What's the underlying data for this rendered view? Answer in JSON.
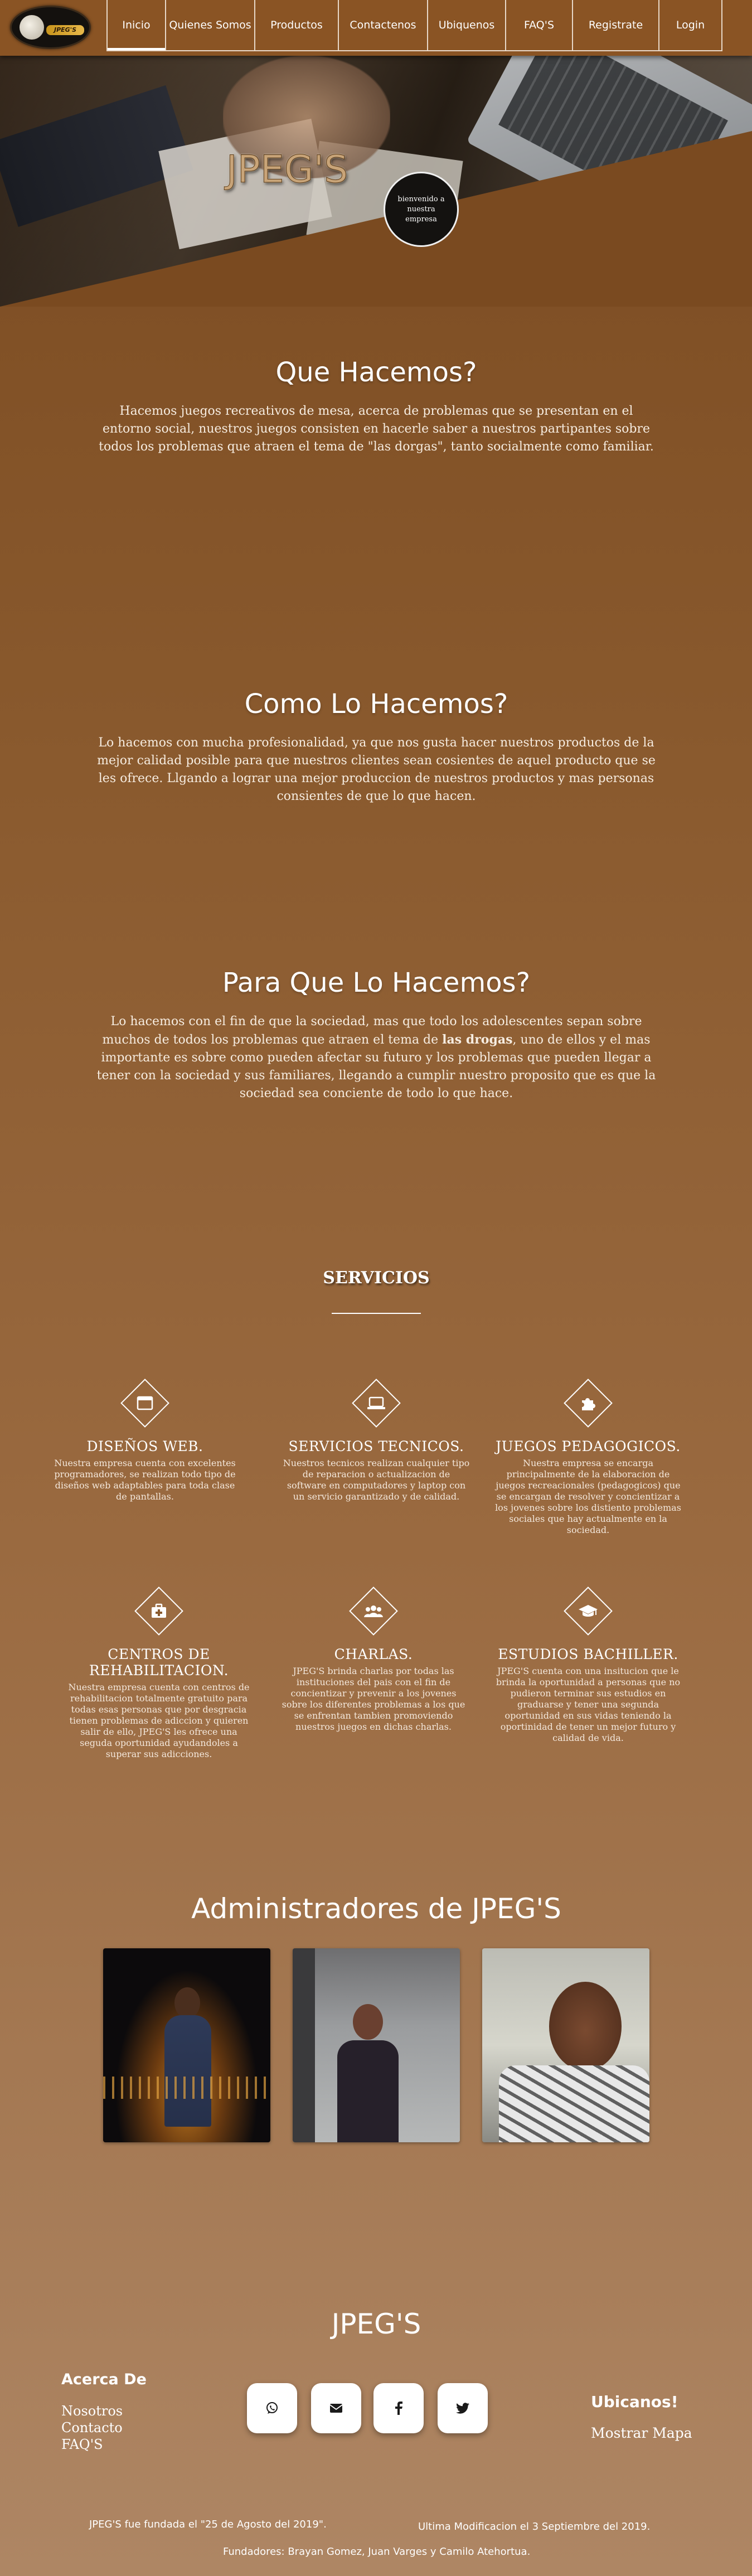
{
  "nav": {
    "logo_text": "JPEG'S",
    "items": [
      {
        "label": "Inicio"
      },
      {
        "label": "Quienes Somos"
      },
      {
        "label": "Productos"
      },
      {
        "label": "Contactenos"
      },
      {
        "label": "Ubiquenos"
      },
      {
        "label": "FAQ'S"
      },
      {
        "label": "Registrate"
      },
      {
        "label": "Login"
      }
    ]
  },
  "hero": {
    "title": "JPEG'S",
    "badge": "bienvenido a nuestra empresa"
  },
  "que": {
    "title": "Que Hacemos?",
    "text": "Hacemos juegos recreativos de mesa, acerca de problemas que se presentan en el entorno social, nuestros juegos consisten en hacerle saber a nuestros partipantes sobre todos los problemas que atraen el tema de \"las dorgas\", tanto socialmente como familiar."
  },
  "como": {
    "title": "Como Lo Hacemos?",
    "text": "Lo hacemos con mucha profesionalidad, ya que nos gusta hacer nuestros productos de la mejor calidad posible para que nuestros clientes sean cosientes de aquel producto que se les ofrece. Llgando a lograr una mejor produccion de nuestros productos y mas personas consientes de que lo que hacen."
  },
  "para": {
    "title": "Para Que Lo Hacemos?",
    "text_before": "Lo hacemos con el fin de que la sociedad, mas que todo los adolescentes sepan sobre muchos de todos los problemas que atraen el tema de ",
    "text_bold": "las drogas",
    "text_after": ", uno de ellos y el mas importante es sobre como pueden afectar su futuro y los problemas que pueden llegar a tener con la sociedad y sus familiares, llegando a cumplir nuestro proposito que es que la sociedad sea conciente de todo lo que hace."
  },
  "servicios": {
    "title": "SERVICIOS",
    "items": [
      {
        "icon": "browser-icon",
        "title": "DISEÑOS WEB.",
        "text": "Nuestra empresa cuenta con excelentes programadores, se realizan todo tipo de diseños web adaptables para toda clase de pantallas."
      },
      {
        "icon": "laptop-icon",
        "title": "SERVICIOS TECNICOS.",
        "text": "Nuestros tecnicos realizan cualquier tipo de reparacion o actualizacion de software en computadores y laptop con un servicio garantizado y de calidad."
      },
      {
        "icon": "puzzle-icon",
        "title": "JUEGOS PEDAGOGICOS.",
        "text": "Nuestra empresa se encarga principalmente de la elaboracion de juegos recreacionales (pedagogicos) que se encargan de resolver y concientizar a los jovenes sobre los distiento problemas sociales que hay actualmente en la sociedad."
      },
      {
        "icon": "medical-kit-icon",
        "title": "CENTROS DE REHABILITACION.",
        "text": "Nuestra empresa cuenta con centros de rehabilitacion totalmente gratuito para todas esas personas que por desgracia tienen problemas de adiccion y quieren salir de ello, JPEG'S les ofrece una seguda oportunidad ayudandoles a superar sus adicciones."
      },
      {
        "icon": "users-icon",
        "title": "CHARLAS.",
        "text": "JPEG'S brinda charlas por todas las instituciones del pais con el fin de concientizar y prevenir a los jovenes sobre los diferentes problemas a los que se enfrentan tambien promoviendo nuestros juegos en dichas charlas."
      },
      {
        "icon": "graduation-cap-icon",
        "title": "ESTUDIOS BACHILLER.",
        "text": "JPEG'S cuenta con una insitucion que le brinda la oportunidad a personas que no pudieron terminar sus estudios en graduarse y tener una segunda oportunidad en sus vidas teniendo la oportinidad de tener un mejor futuro y calidad de vida."
      }
    ]
  },
  "admins": {
    "title": "Administradores de JPEG'S"
  },
  "footer": {
    "title": "JPEG'S",
    "acerca": "Acerca De",
    "links": [
      "Nosotros",
      "Contacto",
      "FAQ'S"
    ],
    "social": [
      {
        "icon": "whatsapp-icon"
      },
      {
        "icon": "envelope-icon"
      },
      {
        "icon": "facebook-icon"
      },
      {
        "icon": "twitter-icon"
      }
    ],
    "ubicanos": "Ubicanos!",
    "mapa": "Mostrar Mapa",
    "fundada": "JPEG'S fue fundada el \"25 de Agosto del 2019\".",
    "modificacion": "Ultima Modificacion el 3 Septiembre del 2019.",
    "fundadores": "Fundadores: Brayan Gomez, Juan Varges y Camilo Atehortua."
  }
}
